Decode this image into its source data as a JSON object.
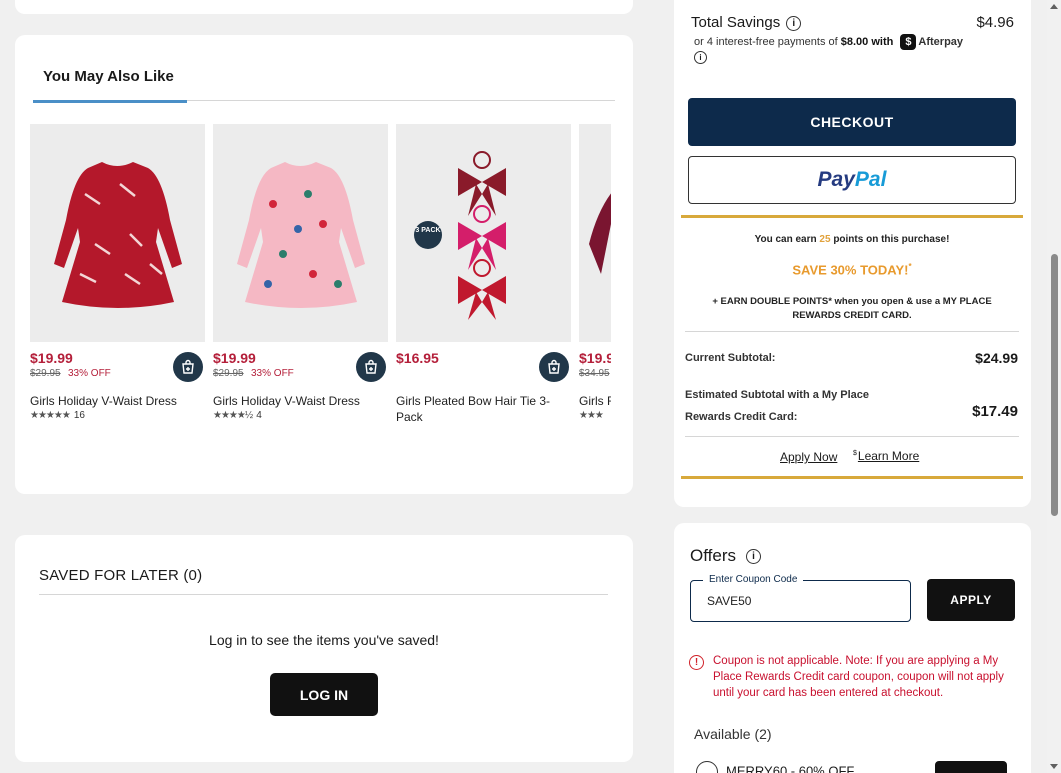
{
  "recommendations": {
    "tab_label": "You May Also Like",
    "products": [
      {
        "price": "$19.99",
        "original": "$29.95",
        "discount": "33% OFF",
        "name": "Girls Holiday V-Waist Dress",
        "stars": "★★★★★",
        "count": "16"
      },
      {
        "price": "$19.99",
        "original": "$29.95",
        "discount": "33% OFF",
        "name": "Girls Holiday V-Waist Dress",
        "stars": "★★★★½",
        "count": "4"
      },
      {
        "price": "$16.95",
        "name": "Girls Pleated Bow Hair Tie 3-Pack",
        "badge": "3 PACK"
      },
      {
        "price": "$19.9",
        "original": "$34.95",
        "name": "Girls F",
        "stars": "★★★"
      }
    ]
  },
  "saved_for_later": {
    "title": "SAVED FOR LATER (0)",
    "message": "Log in to see the items you've saved!",
    "login_label": "LOG IN"
  },
  "summary": {
    "total_savings_label": "Total Savings",
    "total_savings_value": "$4.96",
    "afterpay_prefix": "or 4 interest-free payments of",
    "afterpay_amount": "$8.00",
    "afterpay_with": "with",
    "afterpay_name": "Afterpay",
    "checkout_label": "CHECKOUT",
    "paypal_pay": "Pay",
    "paypal_pal": "Pal",
    "earn_prefix": "You can earn",
    "earn_points": "25",
    "earn_suffix": "points on this purchase!",
    "save_today": "SAVE 30% TODAY!",
    "save_mark": "*",
    "double_points": "+ EARN DOUBLE POINTS* when you open & use a MY PLACE REWARDS CREDIT CARD.",
    "current_subtotal_label": "Current Subtotal:",
    "current_subtotal_value": "$24.99",
    "estimated_label": "Estimated Subtotal with a My Place Rewards Credit Card:",
    "estimated_value": "$17.49",
    "apply_now": "Apply Now",
    "learn_more_prefix": "$",
    "learn_more": "Learn More"
  },
  "offers": {
    "title": "Offers",
    "coupon_label": "Enter Coupon Code",
    "coupon_value": "SAVE50",
    "apply_label": "APPLY",
    "error": "Coupon is not applicable. Note: If you are applying a My Place Rewards Credit card coupon, coupon will not apply until your card has been entered at checkout.",
    "available": "Available (2)",
    "first_offer": "MERRY60 - 60% OFF"
  },
  "colors": {
    "navy": "#0d2a4b",
    "price_red": "#b41f3a",
    "gold": "#d8a93b",
    "error_red": "#c8102e"
  }
}
